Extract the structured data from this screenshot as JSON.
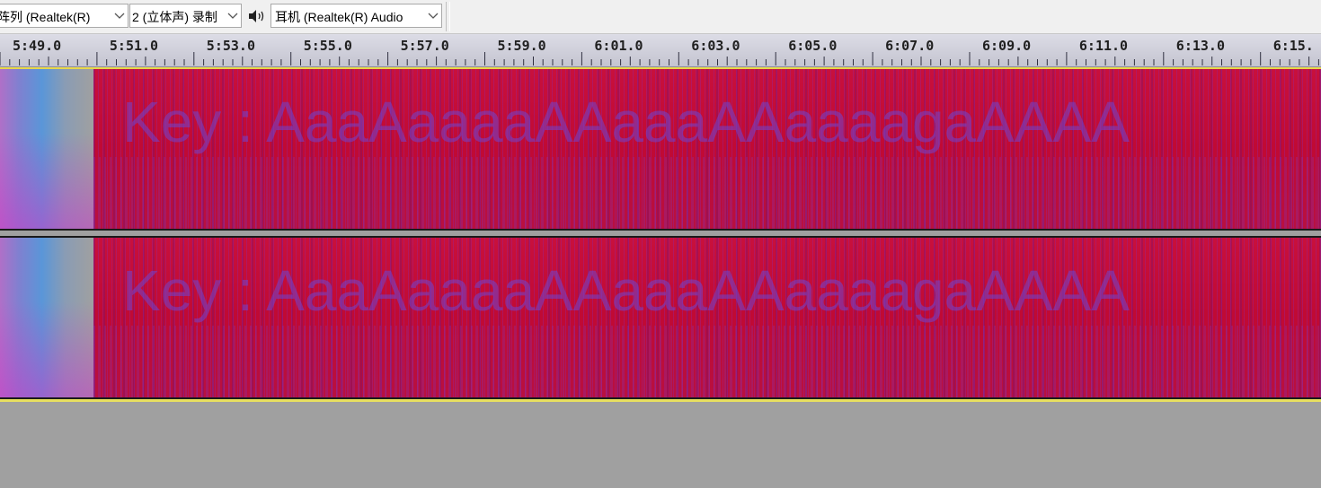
{
  "toolbar": {
    "input_device": "阵列 (Realtek(R)",
    "channels": "2 (立体声) 录制",
    "output_device": "耳机 (Realtek(R) Audio"
  },
  "ruler": {
    "labels": [
      "5:49.0",
      "5:51.0",
      "5:53.0",
      "5:55.0",
      "5:57.0",
      "5:59.0",
      "6:01.0",
      "6:03.0",
      "6:05.0",
      "6:07.0",
      "6:09.0",
      "6:11.0",
      "6:13.0",
      "6:15."
    ]
  },
  "tracks": [
    {
      "visible_text": "Key : AaaAaaaaAAaaaAAaaaagaAAAA"
    },
    {
      "visible_text": "Key : AaaAaaaaAAaaaAAaaaagaAAAA"
    }
  ],
  "colors": {
    "spectrogram_base": "#c8103c",
    "text_overlay": "#6e46d2",
    "track_cursor": "#e8d84a"
  }
}
